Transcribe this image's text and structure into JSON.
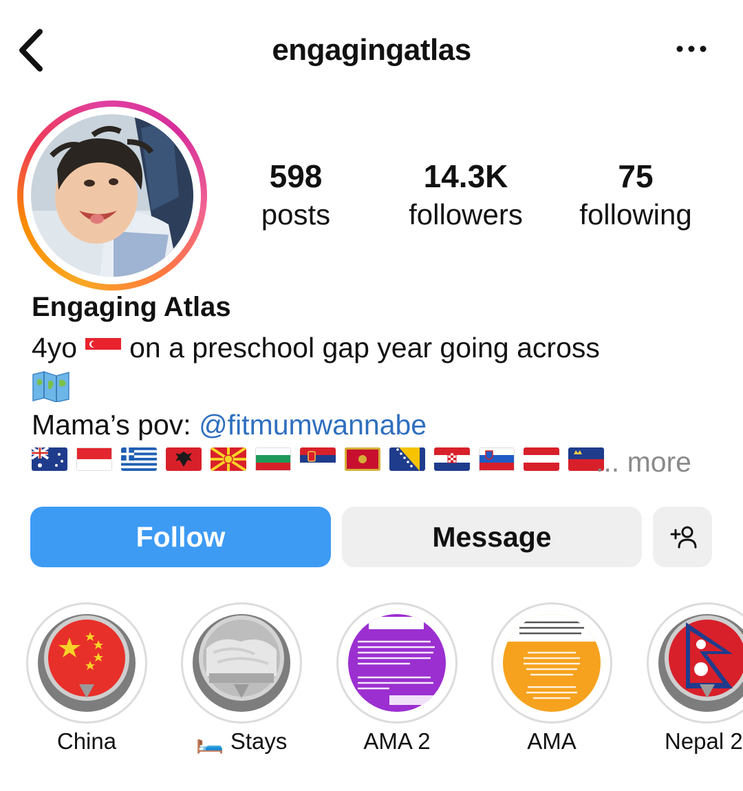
{
  "header": {
    "username": "engagingatlas",
    "back_icon": "chevron-left-icon",
    "more_icon": "more-horizontal-icon"
  },
  "stats": [
    {
      "value": "598",
      "label": "posts"
    },
    {
      "value": "14.3K",
      "label": "followers"
    },
    {
      "value": "75",
      "label": "following"
    }
  ],
  "bio": {
    "name": "Engaging Atlas",
    "line1_prefix": "4yo",
    "line1_flag": "singapore-flag-icon",
    "line1_suffix": "on a preschool gap year going across",
    "line2_icon": "world-map-icon",
    "line3_prefix": "Mama’s pov: ",
    "mention": "@fitmumwannabe",
    "flags": [
      "australia",
      "indonesia",
      "greece",
      "albania",
      "north-macedonia",
      "bulgaria",
      "serbia",
      "montenegro",
      "bosnia",
      "croatia",
      "slovenia",
      "austria",
      "liechtenstein"
    ],
    "more": "... more"
  },
  "buttons": {
    "follow": "Follow",
    "message": "Message",
    "add_user_icon": "add-user-icon"
  },
  "highlights": [
    {
      "label": "China",
      "icon": "china-flag-icon"
    },
    {
      "label": "🛏️ Stays",
      "icon": "bed-photo"
    },
    {
      "label": "AMA 2",
      "icon": "purple-text-story"
    },
    {
      "label": "AMA",
      "icon": "orange-text-story"
    },
    {
      "label": "Nepal 2",
      "icon": "nepal-flag-icon"
    }
  ],
  "colors": {
    "follow_button": "#3d9bf4",
    "mention": "#2f6fbf",
    "secondary_button": "#efefef"
  }
}
